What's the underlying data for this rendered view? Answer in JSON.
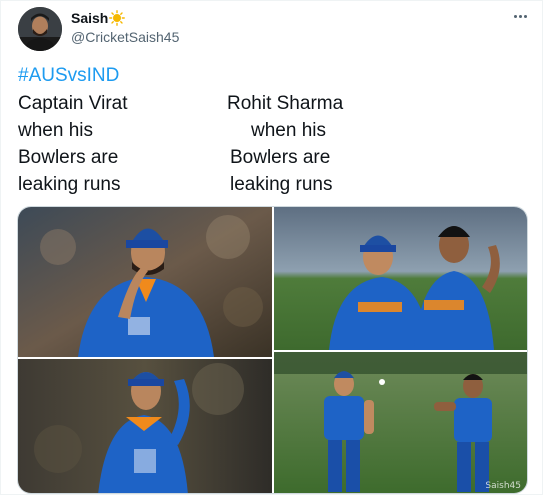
{
  "author": {
    "name": "Saish",
    "handle": "@CricketSaish45",
    "avatar_icon": "profile-photo",
    "name_badge_icon": "sun-emoji-icon"
  },
  "tweet": {
    "hashtag": "#AUSvsIND",
    "left_column": [
      "Captain Virat",
      "when his",
      "Bowlers are",
      "leaking runs"
    ],
    "right_column": [
      "Rohit Sharma",
      "when his",
      "Bowlers are",
      "leaking runs"
    ]
  },
  "media": {
    "images": [
      {
        "name": "virat-thinking-photo"
      },
      {
        "name": "rohit-celebrating-photo"
      },
      {
        "name": "virat-head-down-photo"
      },
      {
        "name": "rohit-fielding-photo"
      }
    ],
    "watermark": "Saish45"
  },
  "colors": {
    "link": "#1d9bf0",
    "text": "#0f1419",
    "secondary": "#536471",
    "jersey": "#1e63c6"
  }
}
